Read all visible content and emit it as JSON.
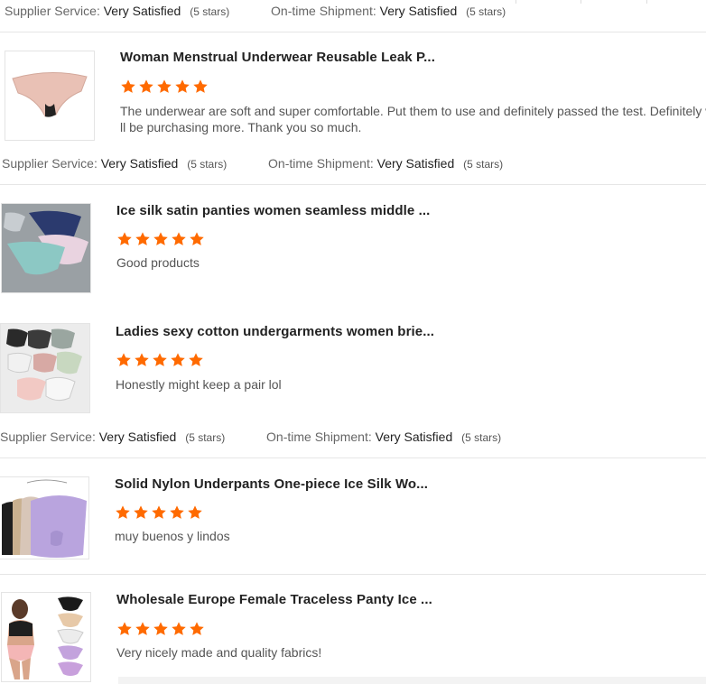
{
  "labels": {
    "supplier_service": "Supplier Service:",
    "on_time_shipment": "On-time Shipment:",
    "very_satisfied": "Very Satisfied",
    "five_stars": "(5 stars)"
  },
  "colors": {
    "star": "#ff6a00",
    "separator": "#e6e6e6"
  },
  "reviews": [
    {
      "title": "Woman Menstrual Underwear Reusable Leak P...",
      "stars": 5,
      "text_line1": "The underwear are soft and super comfortable. Put them to use and definitely passed the test. Definitely wi",
      "text_line2": "ll be purchasing more. Thank you so much."
    },
    {
      "title": "Ice silk satin panties women seamless middle ...",
      "stars": 5,
      "text_line1": "Good products"
    },
    {
      "title": "Ladies sexy cotton undergarments women brie...",
      "stars": 5,
      "text_line1": "Honestly might keep a pair lol"
    },
    {
      "title": "Solid Nylon Underpants One-piece Ice Silk Wo...",
      "stars": 5,
      "text_line1": "muy buenos y lindos"
    },
    {
      "title": "Wholesale Europe Female Traceless Panty Ice ...",
      "stars": 5,
      "text_line1": "Very nicely made and quality fabrics!"
    }
  ]
}
